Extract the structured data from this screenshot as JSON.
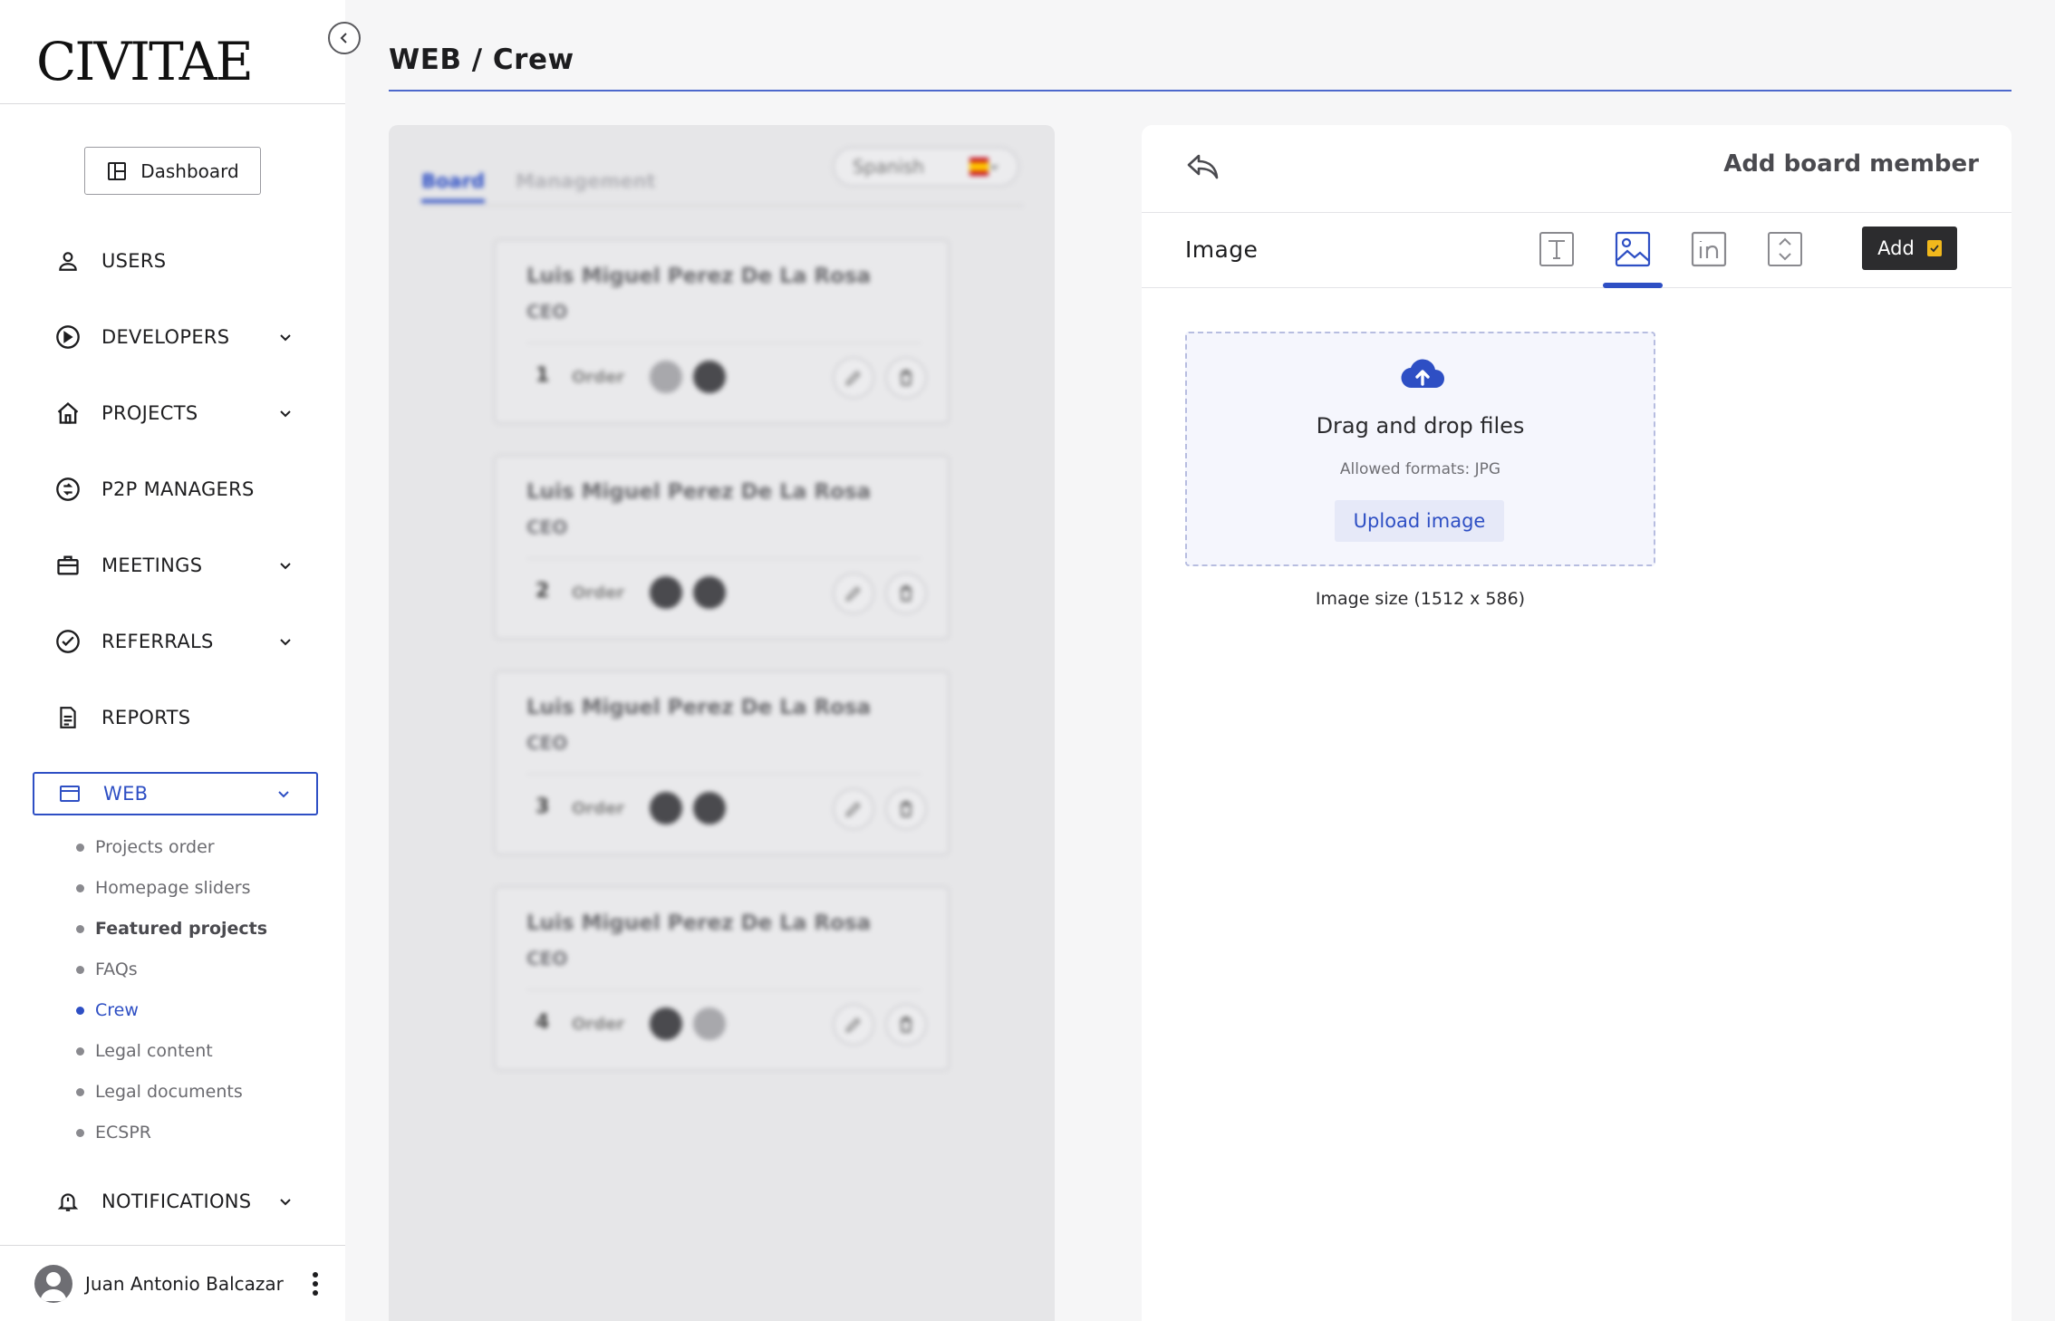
{
  "brand": "CIVITAE",
  "header": {
    "title": "WEB / Crew"
  },
  "sidebar": {
    "dashboard_label": "Dashboard",
    "items": [
      {
        "label": "USERS",
        "icon": "user-icon",
        "expandable": false
      },
      {
        "label": "DEVELOPERS",
        "icon": "developers-icon",
        "expandable": true
      },
      {
        "label": "PROJECTS",
        "icon": "home-icon",
        "expandable": true
      },
      {
        "label": "P2P MANAGERS",
        "icon": "p2p-icon",
        "expandable": false
      },
      {
        "label": "MEETINGS",
        "icon": "briefcase-icon",
        "expandable": true
      },
      {
        "label": "REFERRALS",
        "icon": "check-circle-icon",
        "expandable": true
      },
      {
        "label": "REPORTS",
        "icon": "document-icon",
        "expandable": false
      },
      {
        "label": "WEB",
        "icon": "browser-icon",
        "expandable": true,
        "active": true
      },
      {
        "label": "NOTIFICATIONS",
        "icon": "bell-icon",
        "expandable": true
      }
    ],
    "web_subitems": [
      "Projects order",
      "Homepage sliders",
      "Featured projects",
      "FAQs",
      "Crew",
      "Legal content",
      "Legal documents",
      "ECSPR"
    ],
    "current_subitem": "Crew",
    "user": {
      "name": "Juan Antonio Balcazar"
    }
  },
  "board_panel": {
    "tabs": [
      "Board",
      "Management"
    ],
    "active_tab": "Board",
    "language": "Spanish",
    "order_label": "Order",
    "members": [
      {
        "name": "Luis Miguel Perez De La Rosa",
        "role": "CEO",
        "order": "1"
      },
      {
        "name": "Luis Miguel Perez De La Rosa",
        "role": "CEO",
        "order": "2"
      },
      {
        "name": "Luis Miguel Perez De La Rosa",
        "role": "CEO",
        "order": "3"
      },
      {
        "name": "Luis Miguel Perez De La Rosa",
        "role": "CEO",
        "order": "4"
      }
    ]
  },
  "form": {
    "title": "Add board member",
    "section_label": "Image",
    "add_label": "Add",
    "dropzone": {
      "title": "Drag and drop files",
      "formats": "Allowed formats: JPG",
      "upload_label": "Upload image"
    },
    "image_size": "Image size (1512 x 586)"
  },
  "colors": {
    "accent": "#2e4fc4",
    "add_button": "#2c2c2e",
    "add_check": "#f1b81c"
  }
}
